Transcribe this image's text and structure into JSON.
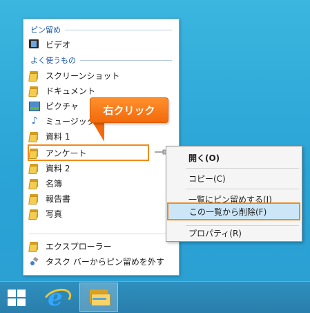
{
  "jumplist": {
    "pinned_header": "ピン留め",
    "pinned_items": [
      {
        "label": "ビデオ",
        "icon": "video-library-icon"
      }
    ],
    "frequent_header": "よく使うもの",
    "frequent_items": [
      {
        "label": "スクリーンショット",
        "icon": "folder-icon"
      },
      {
        "label": "ドキュメント",
        "icon": "documents-icon"
      },
      {
        "label": "ピクチャ",
        "icon": "pictures-icon"
      },
      {
        "label": "ミュージック",
        "icon": "music-icon"
      },
      {
        "label": "資料 1",
        "icon": "folder-icon"
      },
      {
        "label": "アンケート",
        "icon": "folder-icon"
      },
      {
        "label": "資料 2",
        "icon": "folder-icon"
      },
      {
        "label": "名簿",
        "icon": "folder-icon"
      },
      {
        "label": "報告書",
        "icon": "folder-icon"
      },
      {
        "label": "写真",
        "icon": "folder-icon"
      }
    ],
    "tasks": [
      {
        "label": "エクスプローラー",
        "icon": "explorer-icon"
      },
      {
        "label": "タスク バーからピン留めを外す",
        "icon": "unpin-icon"
      }
    ]
  },
  "callout": {
    "label": "右クリック",
    "color": "#f26a0b"
  },
  "context_menu": {
    "items": [
      {
        "label": "開く(O)",
        "bold": true
      },
      {
        "label": "コピー(C)"
      },
      {
        "label": "一覧にピン留めする(I)"
      },
      {
        "label": "この一覧から削除(F)",
        "highlighted": true
      },
      {
        "label": "プロパティ(R)"
      }
    ]
  },
  "colors": {
    "accent": "#f08a1b",
    "header_text": "#1c57a8",
    "taskbar": "#2a7eab"
  },
  "taskbar": {
    "buttons": [
      "start-button",
      "internet-explorer-button",
      "file-explorer-button"
    ]
  }
}
